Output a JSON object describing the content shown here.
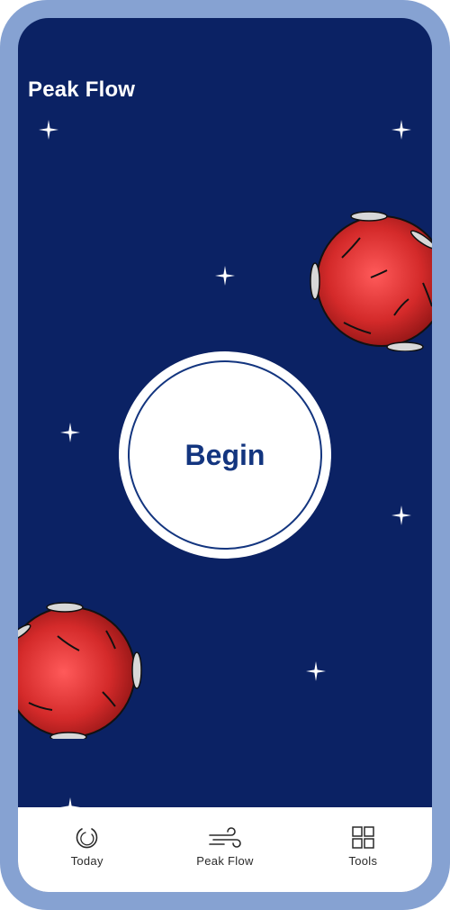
{
  "screen": {
    "title": "Peak Flow",
    "begin_label": "Begin"
  },
  "tabs": [
    {
      "label": "Today",
      "icon": "today-ring-icon"
    },
    {
      "label": "Peak Flow",
      "icon": "wind-icon"
    },
    {
      "label": "Tools",
      "icon": "grid-icon"
    }
  ],
  "colors": {
    "background": "#0b2264",
    "accent": "#13357f",
    "frame": "#86a2d2",
    "virus": "#d22c2c"
  }
}
